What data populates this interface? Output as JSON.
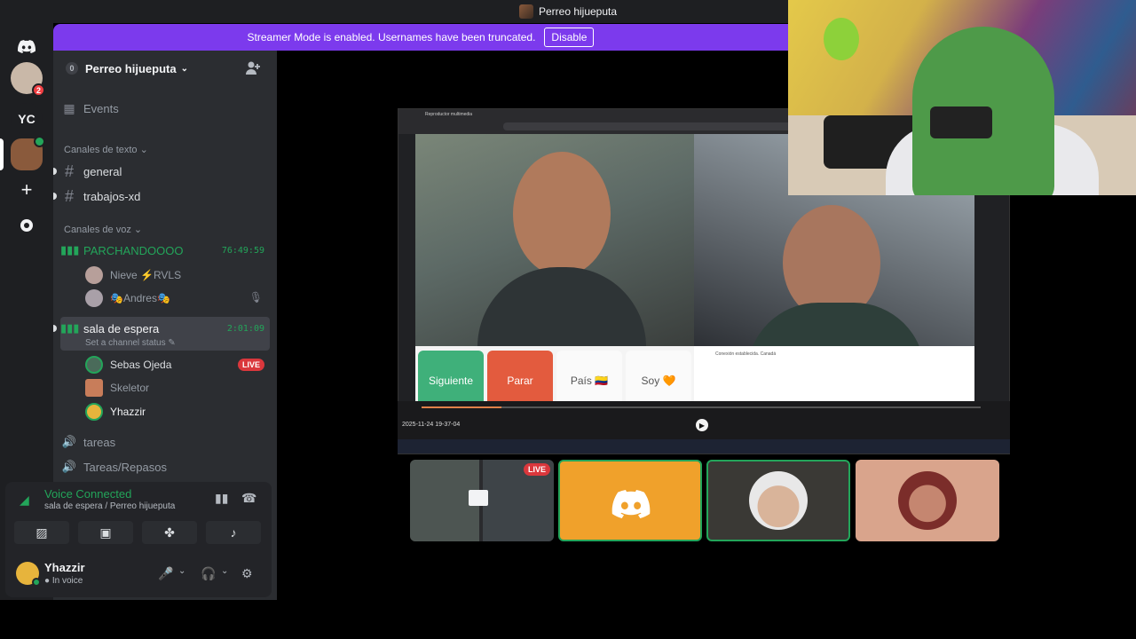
{
  "window": {
    "title": "Perreo hijueputa"
  },
  "banner": {
    "text": "Streamer Mode is enabled. Usernames have been truncated.",
    "button": "Disable"
  },
  "rail": {
    "dm_badge": "2",
    "server_initials": "YC"
  },
  "guild": {
    "count": "0",
    "name": "Perreo hijueputa"
  },
  "sidebar": {
    "events": "Events",
    "text_category": "Canales de texto",
    "text_channels": [
      "general",
      "trabajos-xd"
    ],
    "voice_category": "Canales de voz",
    "voice_channels": [
      {
        "name": "PARCHANDOOOO",
        "timer": "76:49:59",
        "members": [
          "Nieve ⚡RVLS",
          "🎭Andres🎭"
        ]
      },
      {
        "name": "sala de espera",
        "timer": "2:01:09",
        "status": "Set a channel status",
        "members": [
          "Sebas Ojeda",
          "Skeletor",
          "Yhazzir"
        ],
        "live": "LIVE"
      },
      {
        "name": "tareas"
      },
      {
        "name": "Tareas/Repasos"
      }
    ]
  },
  "voice_panel": {
    "title": "Voice Connected",
    "subtitle": "sala de espera / Perreo hijueputa"
  },
  "user_panel": {
    "name": "Yhazzir",
    "status": "In voice"
  },
  "stream": {
    "tab_title": "Reproductor multimedia",
    "buttons": [
      "Siguiente",
      "Parar",
      "País 🇨🇴",
      "Soy 🧡"
    ],
    "chat": "Conexión establecida. Canadá",
    "timestamp": "2025-11-24 19-37-04"
  },
  "tiles": {
    "live": "LIVE"
  },
  "colors": {
    "accent": "#7c3aed",
    "voice_green": "#23a55a",
    "live_red": "#da373c",
    "discord_orange": "#f0a12b"
  }
}
